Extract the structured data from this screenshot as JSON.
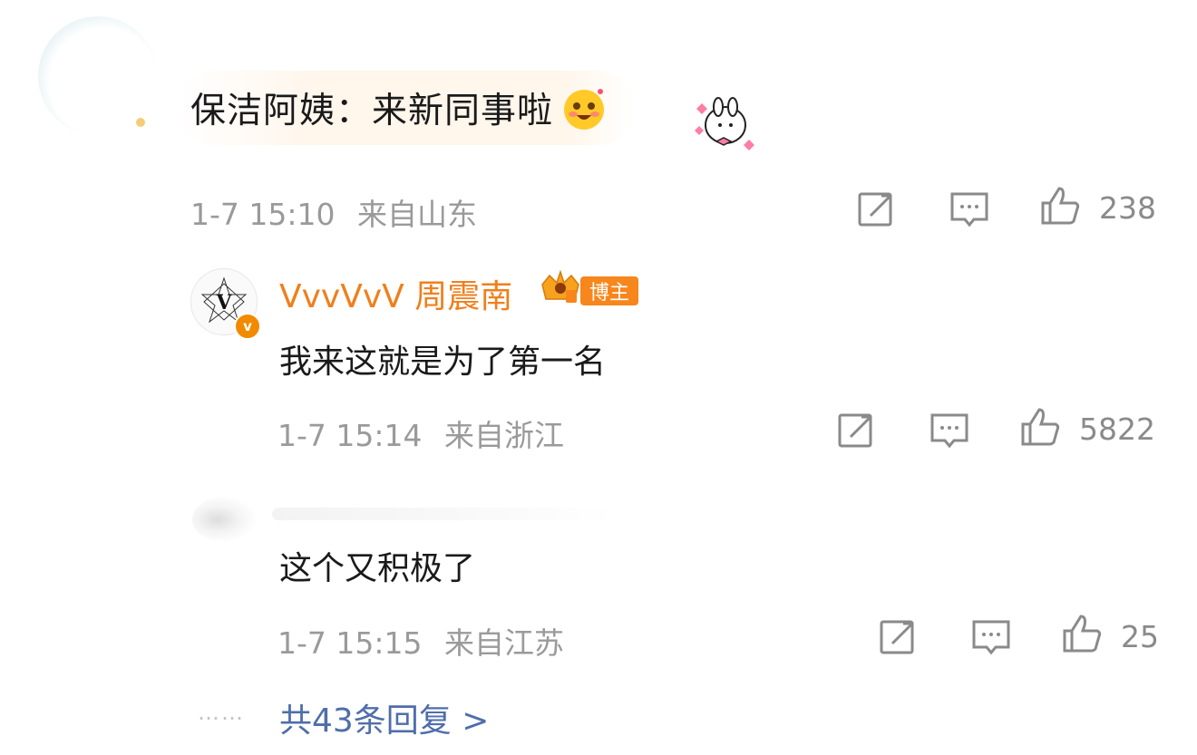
{
  "main": {
    "comment_text": "保洁阿姨：来新同事啦",
    "emoji_icon": "smiling-blush-face-icon",
    "sticker_icon": "bunny-hearts-sticker-icon",
    "time": "1-7 15:10",
    "location": "来自山东",
    "like_count": "238"
  },
  "replies": [
    {
      "name": "VvvVvV 周震南",
      "author_tag": "博主",
      "avatar_letter": "V",
      "verify_icon": "v-verified-icon",
      "text": "我来这就是为了第一名",
      "time": "1-7 15:14",
      "location": "来自浙江",
      "like_count": "5822"
    },
    {
      "text": "这个又积极了",
      "time": "1-7 15:15",
      "location": "来自江苏",
      "like_count": "25"
    }
  ],
  "footer": {
    "dots": "……",
    "total_replies": "共43条回复 >"
  },
  "colors": {
    "name": "#f07f1b",
    "tag": "#f7861c",
    "link": "#4f6eaa",
    "meta": "#9a9a9a"
  }
}
